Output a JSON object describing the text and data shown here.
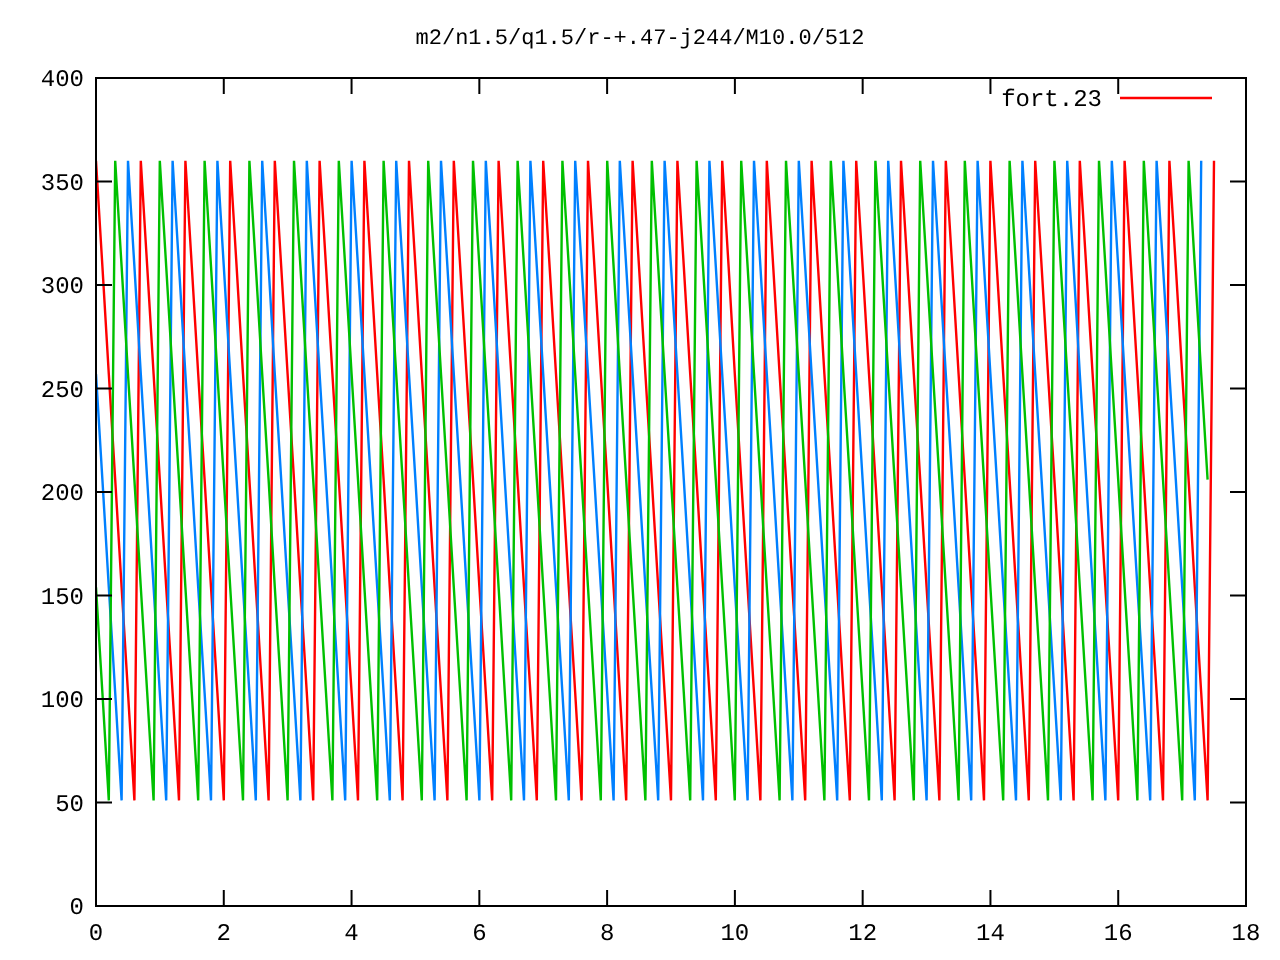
{
  "chart_data": {
    "type": "line",
    "title": "m2/n1.5/q1.5/r-+.47-j244/M10.0/512",
    "xlim": [
      0,
      18
    ],
    "ylim": [
      0,
      400
    ],
    "xticks": [
      0,
      2,
      4,
      6,
      8,
      10,
      12,
      14,
      16,
      18
    ],
    "yticks": [
      0,
      50,
      100,
      150,
      200,
      250,
      300,
      350,
      400
    ],
    "x": [
      0,
      0.1,
      0.2,
      0.3,
      0.4,
      0.5,
      0.6,
      0.7,
      0.8,
      0.9,
      1,
      1.1,
      1.2,
      1.3,
      1.4,
      1.5,
      1.6,
      1.7,
      1.8,
      1.9,
      2,
      2.1,
      2.2,
      2.3,
      2.4,
      2.5,
      2.6,
      2.7,
      2.8,
      2.9,
      3,
      3.1,
      3.2,
      3.3,
      3.4,
      3.5,
      3.6,
      3.7,
      3.8,
      3.9,
      4,
      4.1,
      4.2,
      4.3,
      4.4,
      4.5,
      4.6,
      4.7,
      4.8,
      4.9,
      5,
      5.1,
      5.2,
      5.3,
      5.4,
      5.5,
      5.6,
      5.7,
      5.8,
      5.9,
      6,
      6.1,
      6.2,
      6.3,
      6.4,
      6.5,
      6.6,
      6.7,
      6.8,
      6.9,
      7,
      7.1,
      7.2,
      7.3,
      7.4,
      7.5,
      7.6,
      7.7,
      7.8,
      7.9,
      8,
      8.1,
      8.2,
      8.3,
      8.4,
      8.5,
      8.6,
      8.7,
      8.8,
      8.9,
      9,
      9.1,
      9.2,
      9.3,
      9.4,
      9.5,
      9.6,
      9.7,
      9.8,
      9.9,
      10,
      10.1,
      10.2,
      10.3,
      10.4,
      10.5,
      10.6,
      10.7,
      10.8,
      10.9,
      11,
      11.1,
      11.2,
      11.3,
      11.4,
      11.5,
      11.6,
      11.7,
      11.8,
      11.9,
      12,
      12.1,
      12.2,
      12.3,
      12.4,
      12.5,
      12.6,
      12.7,
      12.8,
      12.9,
      13,
      13.1,
      13.2,
      13.3,
      13.4,
      13.5,
      13.6,
      13.7,
      13.8,
      13.9,
      14,
      14.1,
      14.2,
      14.3,
      14.4,
      14.5,
      14.6,
      14.7,
      14.8,
      14.9,
      15,
      15.1,
      15.2,
      15.3,
      15.4,
      15.5,
      15.6,
      15.7,
      15.8,
      15.9,
      16,
      16.1,
      16.2,
      16.3,
      16.4,
      16.5,
      16.6,
      16.7,
      16.8,
      16.9,
      17,
      17.1,
      17.2,
      17.3,
      17.4,
      17.5
    ],
    "series": [
      {
        "name": "fort.23",
        "color": "#ff0000",
        "values": [
          360,
          309,
          257,
          206,
          154,
          103,
          51,
          360,
          309,
          257,
          206,
          154,
          103,
          51,
          360,
          309,
          257,
          206,
          154,
          103,
          51,
          360,
          309,
          257,
          206,
          154,
          103,
          51,
          360,
          309,
          257,
          206,
          154,
          103,
          51,
          360,
          309,
          257,
          206,
          154,
          103,
          51,
          360,
          309,
          257,
          206,
          154,
          103,
          51,
          360,
          309,
          257,
          206,
          154,
          103,
          51,
          360,
          309,
          257,
          206,
          154,
          103,
          51,
          360,
          309,
          257,
          206,
          154,
          103,
          51,
          360,
          309,
          257,
          206,
          154,
          103,
          51,
          360,
          309,
          257,
          206,
          154,
          103,
          51,
          360,
          309,
          257,
          206,
          154,
          103,
          51,
          360,
          309,
          257,
          206,
          154,
          103,
          51,
          360,
          309,
          257,
          206,
          154,
          103,
          51,
          360,
          309,
          257,
          206,
          154,
          103,
          51,
          360,
          309,
          257,
          206,
          154,
          103,
          51,
          360,
          309,
          257,
          206,
          154,
          103,
          51,
          360,
          309,
          257,
          206,
          154,
          103,
          51,
          360,
          309,
          257,
          206,
          154,
          103,
          51,
          360,
          309,
          257,
          206,
          154,
          103,
          51,
          360,
          309,
          257,
          206,
          154,
          103,
          51,
          360,
          309,
          257,
          206,
          154,
          103,
          51,
          360,
          309,
          257,
          206,
          154,
          103,
          51,
          360,
          309,
          257,
          206,
          154,
          103,
          51,
          360
        ]
      },
      {
        "color": "#0080ff",
        "values": [
          257,
          206,
          154,
          103,
          51,
          360,
          309,
          257,
          206,
          154,
          103,
          51,
          360,
          309,
          257,
          206,
          154,
          103,
          51,
          360,
          309,
          257,
          206,
          154,
          103,
          51,
          360,
          309,
          257,
          206,
          154,
          103,
          51,
          360,
          309,
          257,
          206,
          154,
          103,
          51,
          360,
          309,
          257,
          206,
          154,
          103,
          51,
          360,
          309,
          257,
          206,
          154,
          103,
          51,
          360,
          309,
          257,
          206,
          154,
          103,
          51,
          360,
          309,
          257,
          206,
          154,
          103,
          51,
          360,
          309,
          257,
          206,
          154,
          103,
          51,
          360,
          309,
          257,
          206,
          154,
          103,
          51,
          360,
          309,
          257,
          206,
          154,
          103,
          51,
          360,
          309,
          257,
          206,
          154,
          103,
          51,
          360,
          309,
          257,
          206,
          154,
          103,
          51,
          360,
          309,
          257,
          206,
          154,
          103,
          51,
          360,
          309,
          257,
          206,
          154,
          103,
          51,
          360,
          309,
          257,
          206,
          154,
          103,
          51,
          360,
          309,
          257,
          206,
          154,
          103,
          51,
          360,
          309,
          257,
          206,
          154,
          103,
          51,
          360,
          309,
          257,
          206,
          154,
          103,
          51,
          360,
          309,
          257,
          206,
          154,
          103,
          51,
          360,
          309,
          257,
          206,
          154,
          103,
          51,
          360,
          309,
          257,
          206,
          154,
          103,
          51,
          360,
          309,
          257,
          206,
          154,
          103,
          51,
          360,
          null,
          null
        ]
      },
      {
        "color": "#00c000",
        "values": [
          154,
          103,
          51,
          360,
          309,
          257,
          206,
          154,
          103,
          51,
          360,
          309,
          257,
          206,
          154,
          103,
          51,
          360,
          309,
          257,
          206,
          154,
          103,
          51,
          360,
          309,
          257,
          206,
          154,
          103,
          51,
          360,
          309,
          257,
          206,
          154,
          103,
          51,
          360,
          309,
          257,
          206,
          154,
          103,
          51,
          360,
          309,
          257,
          206,
          154,
          103,
          51,
          360,
          309,
          257,
          206,
          154,
          103,
          51,
          360,
          309,
          257,
          206,
          154,
          103,
          51,
          360,
          309,
          257,
          206,
          154,
          103,
          51,
          360,
          309,
          257,
          206,
          154,
          103,
          51,
          360,
          309,
          257,
          206,
          154,
          103,
          51,
          360,
          309,
          257,
          206,
          154,
          103,
          51,
          360,
          309,
          257,
          206,
          154,
          103,
          51,
          360,
          309,
          257,
          206,
          154,
          103,
          51,
          360,
          309,
          257,
          206,
          154,
          103,
          51,
          360,
          309,
          257,
          206,
          154,
          103,
          51,
          360,
          309,
          257,
          206,
          154,
          103,
          51,
          360,
          309,
          257,
          206,
          154,
          103,
          51,
          360,
          309,
          257,
          206,
          154,
          103,
          51,
          360,
          309,
          257,
          206,
          154,
          103,
          51,
          360,
          309,
          257,
          206,
          154,
          103,
          51,
          360,
          309,
          257,
          206,
          154,
          103,
          51,
          360,
          309,
          257,
          206,
          154,
          103,
          51,
          360,
          309,
          257,
          206,
          null
        ]
      }
    ]
  }
}
